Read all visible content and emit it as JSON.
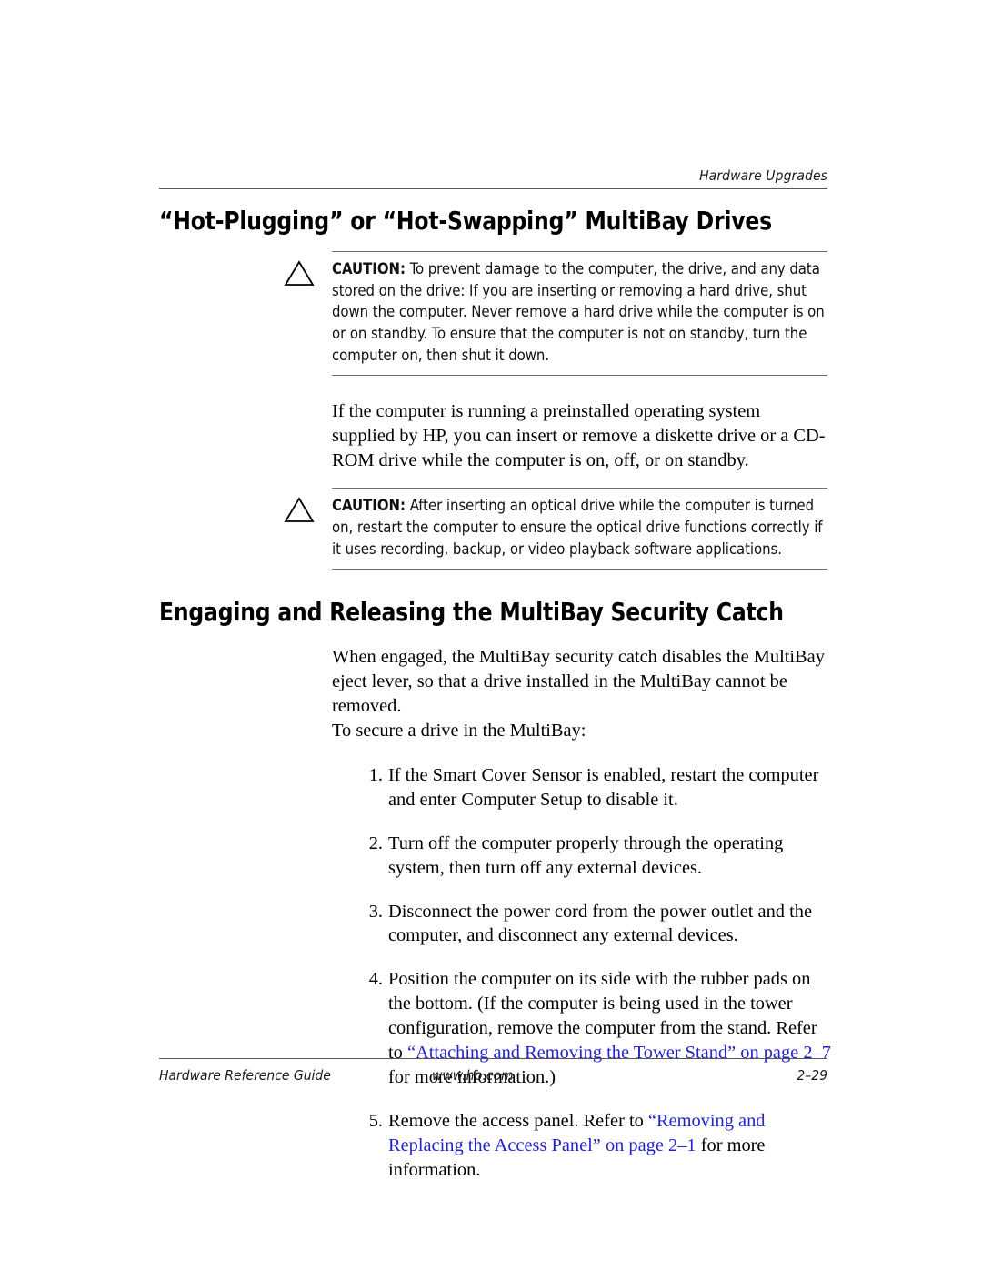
{
  "header": {
    "running_title": "Hardware Upgrades"
  },
  "sections": [
    {
      "heading": "“Hot-Plugging” or “Hot-Swapping” MultiBay Drives"
    },
    {
      "heading": "Engaging and Releasing the MultiBay Security Catch"
    }
  ],
  "cautions": [
    {
      "label": "CAUTION:",
      "icon": "warning-triangle-icon",
      "text": " To prevent damage to the computer, the drive, and any data stored on the drive: If you are inserting or removing a hard drive, shut down the computer. Never remove a hard drive while the computer is on or on standby. To ensure that the computer is not on standby, turn the computer on, then shut it down."
    },
    {
      "label": "CAUTION:",
      "icon": "warning-triangle-icon",
      "text": " After inserting an optical drive while the computer is turned on, restart the computer to ensure the optical drive functions correctly if it uses recording, backup, or video playback software applications."
    }
  ],
  "paragraphs": {
    "intro": "If the computer is running a preinstalled operating system supplied by HP, you can insert or remove a diskette drive or a CD-ROM drive while the computer is on, off, or on standby.",
    "catch_intro": "When engaged, the MultiBay security catch disables the MultiBay eject lever, so that a drive installed in the MultiBay cannot be removed.",
    "secure_lead": "To secure a drive in the MultiBay:"
  },
  "steps": [
    {
      "number": "1.",
      "text": "If the Smart Cover Sensor is enabled, restart the computer and enter Computer Setup to disable it."
    },
    {
      "number": "2.",
      "text": "Turn off the computer properly through the operating system, then turn off any external devices."
    },
    {
      "number": "3.",
      "text": "Disconnect the power cord from the power outlet and the computer, and disconnect any external devices."
    },
    {
      "number": "4.",
      "text_before": "Position the computer on its side with the rubber pads on the bottom. (If the computer is being used in the tower configuration, remove the computer from the stand. Refer to ",
      "link": "“Attaching and Removing the Tower Stand” on page 2–7",
      "text_after": " for more information.)"
    },
    {
      "number": "5.",
      "text_before": "Remove the access panel. Refer to ",
      "link": "“Removing and Replacing the Access Panel” on page 2–1",
      "text_after": " for more information."
    }
  ],
  "footer": {
    "guide_title": "Hardware Reference Guide",
    "website": "www.hp.com",
    "page_number": "2–29"
  },
  "colors": {
    "link": "#2323cc",
    "rule": "#55565a",
    "caution_rule": "#6d6e71",
    "text": "#000000"
  }
}
